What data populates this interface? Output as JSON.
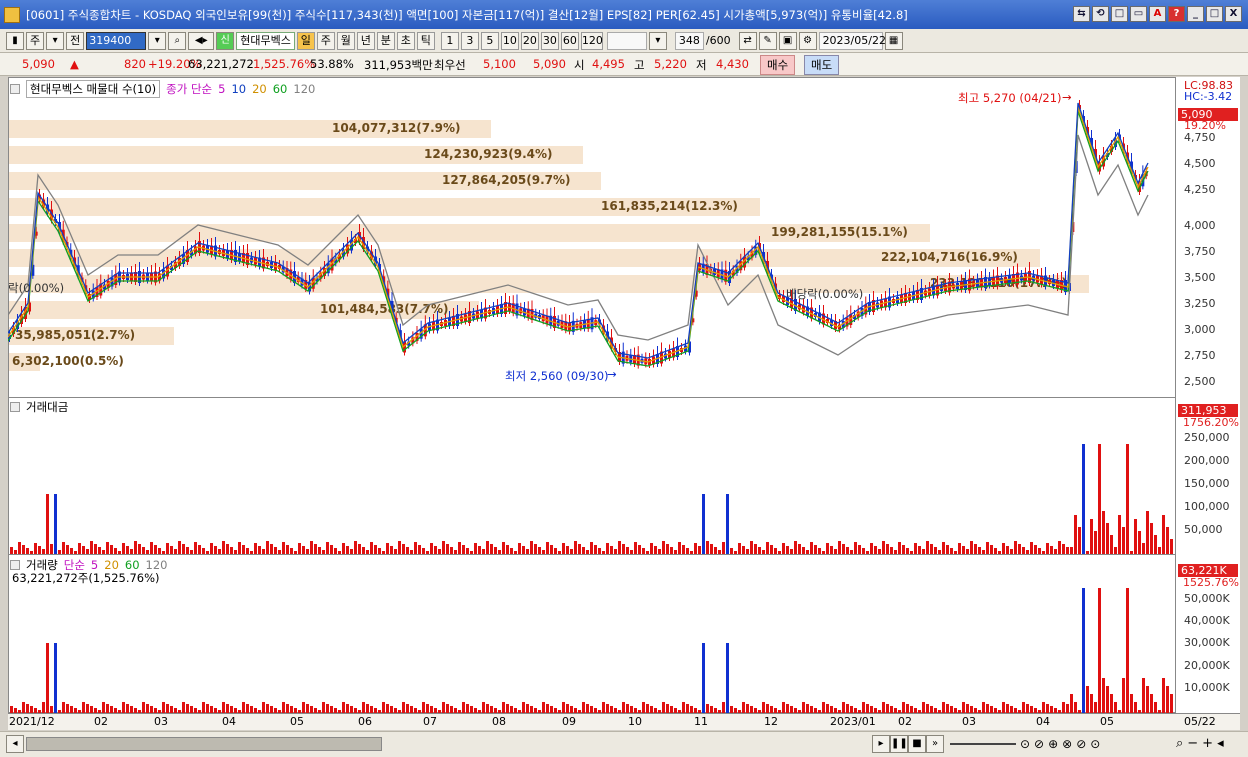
{
  "window": {
    "title": "[0601] 주식종합차트 - KOSDAQ 외국인보유[99(천)] 주식수[117,343(천)] 액면[100] 자본금[117(억)] 결산[12월] EPS[82] PER[62.45] 시가총액[5,973(억)] 유통비율[42.8]",
    "buttons": [
      "⇆",
      "⟲",
      "□",
      "▭",
      "A",
      "?",
      "_",
      "□",
      "X"
    ]
  },
  "toolbar": {
    "mode_select": "주",
    "jeon": "전",
    "code": "319400",
    "stock_name": "현대무벡스",
    "periods": [
      "일",
      "주",
      "월",
      "년",
      "분",
      "초",
      "틱"
    ],
    "selected_period": "일",
    "intervals": [
      "1",
      "3",
      "5",
      "10",
      "20",
      "30",
      "60",
      "120"
    ],
    "count_display": "348",
    "count_total": "/600",
    "date": "2023/05/22"
  },
  "quote": {
    "price": "5,090",
    "change_arrow": "▲",
    "change": "820",
    "change_pct": "+19.20%",
    "volume": "63,221,272",
    "volume_ratio": "1,525.76%",
    "turnover": "53.88%",
    "value_label": "311,953백만",
    "best_bid_label": "최우선",
    "best_ask": "5,100",
    "best_bid": "5,090",
    "open_label": "시",
    "open": "4,495",
    "high_label": "고",
    "high": "5,220",
    "low_label": "저",
    "low": "4,430",
    "buy_label": "매수",
    "sell_label": "매도"
  },
  "price_panel": {
    "title": "현대무벡스 매물대 수(10)",
    "ma_label": "종가 단순",
    "ma_periods": [
      "5",
      "10",
      "20",
      "60",
      "120"
    ],
    "ma_colors": [
      "#d020d0",
      "#1040c0",
      "#e0a000",
      "#10a020",
      "#808080"
    ],
    "lc": "LC:98.83",
    "hc": "HC:-3.42",
    "last_price": "5,090",
    "last_pct": "19.20%",
    "high_annot": "최고 5,270 (04/21)",
    "low_annot": "최저 2,560 (09/30)",
    "partial_left": "락(0.00%)",
    "partial_mid": "배당락(0.00%)",
    "y_ticks": [
      "4,750",
      "4,500",
      "4,250",
      "4,000",
      "3,750",
      "3,500",
      "3,250",
      "3,000",
      "2,750",
      "2,500"
    ],
    "volume_profile": [
      {
        "label": "104,077,312(7.9%)",
        "share": 0.079
      },
      {
        "label": "124,230,923(9.4%)",
        "share": 0.094
      },
      {
        "label": "127,864,205(9.7%)",
        "share": 0.097
      },
      {
        "label": "161,835,214(12.3%)",
        "share": 0.123
      },
      {
        "label": "199,281,155(15.1%)",
        "share": 0.151
      },
      {
        "label": "222,104,716(16.9%)",
        "share": 0.169
      },
      {
        "label": "233,131,110(17.7%)",
        "share": 0.177
      },
      {
        "label": "101,484,583(7.7%)",
        "share": 0.077
      },
      {
        "label": "35,985,051(2.7%)",
        "share": 0.027
      },
      {
        "label": "6,302,100(0.5%)",
        "share": 0.005
      }
    ]
  },
  "value_panel": {
    "title": "거래대금",
    "last": "311,953",
    "last_pct": "1756.20%",
    "y_ticks": [
      "250,000",
      "200,000",
      "150,000",
      "100,000",
      "50,000"
    ]
  },
  "volume_panel": {
    "title": "거래량",
    "ma_label": "단순",
    "ma_periods": [
      "5",
      "20",
      "60",
      "120"
    ],
    "summary": "63,221,272주(1,525.76%)",
    "last": "63,221K",
    "last_pct": "1525.76%",
    "y_ticks": [
      "50,000K",
      "40,000K",
      "30,000K",
      "20,000K",
      "10,000K"
    ]
  },
  "x_axis": {
    "labels": [
      "2021/12",
      "02",
      "03",
      "04",
      "05",
      "06",
      "07",
      "08",
      "09",
      "10",
      "11",
      "12",
      "2023/01",
      "02",
      "03",
      "04",
      "05"
    ],
    "right_label": "05/22"
  }
}
